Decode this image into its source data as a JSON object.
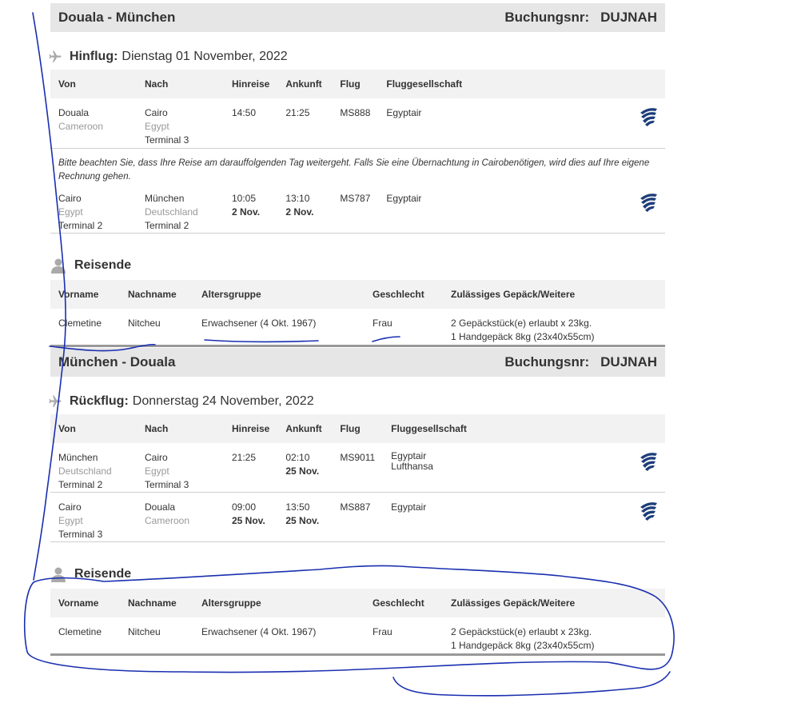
{
  "outbound": {
    "route": "Douala - München",
    "booking_label": "Buchungsnr:",
    "booking_no": "DUJNAH",
    "direction_label": "Hinflug:",
    "date": "Dienstag 01 November, 2022",
    "headers": [
      "Von",
      "Nach",
      "Hinreise",
      "Ankunft",
      "Flug",
      "Fluggesellschaft"
    ],
    "legs": [
      {
        "from_city": "Douala",
        "from_country": "Cameroon",
        "from_terminal": "",
        "to_city": "Cairo",
        "to_country": "Egypt",
        "to_terminal": "Terminal 3",
        "dep": "14:50",
        "dep_date": "",
        "arr": "21:25",
        "arr_date": "",
        "flight": "MS888",
        "airline": "Egyptair",
        "airline2": ""
      },
      {
        "from_city": "Cairo",
        "from_country": "Egypt",
        "from_terminal": "Terminal 2",
        "to_city": "München",
        "to_country": "Deutschland",
        "to_terminal": "Terminal 2",
        "dep": "10:05",
        "dep_date": "2 Nov.",
        "arr": "13:10",
        "arr_date": "2 Nov.",
        "flight": "MS787",
        "airline": "Egyptair",
        "airline2": ""
      }
    ],
    "note": "Bitte beachten Sie, dass Ihre Reise am darauffolgenden Tag weitergeht. Falls Sie eine Übernachtung in Cairobenötigen, wird dies auf Ihre eigene Rechnung gehen."
  },
  "return": {
    "route": "München - Douala",
    "booking_label": "Buchungsnr:",
    "booking_no": "DUJNAH",
    "direction_label": "Rückflug:",
    "date": "Donnerstag 24 November, 2022",
    "headers": [
      "Von",
      "Nach",
      "Hinreise",
      "Ankunft",
      "Flug",
      "Fluggesellschaft"
    ],
    "legs": [
      {
        "from_city": "München",
        "from_country": "Deutschland",
        "from_terminal": "Terminal 2",
        "to_city": "Cairo",
        "to_country": "Egypt",
        "to_terminal": "Terminal 3",
        "dep": "21:25",
        "dep_date": "",
        "arr": "02:10",
        "arr_date": "25 Nov.",
        "flight": "MS9011",
        "airline": "Egyptair",
        "airline2": "Lufthansa"
      },
      {
        "from_city": "Cairo",
        "from_country": "Egypt",
        "from_terminal": "Terminal 3",
        "to_city": "Douala",
        "to_country": "Cameroon",
        "to_terminal": "",
        "dep": "09:00",
        "dep_date": "25 Nov.",
        "arr": "13:50",
        "arr_date": "25 Nov.",
        "flight": "MS887",
        "airline": "Egyptair",
        "airline2": ""
      }
    ]
  },
  "travellers": {
    "title": "Reisende",
    "headers": [
      "Vorname",
      "Nachname",
      "Altersgruppe",
      "Geschlecht",
      "Zulässiges Gepäck/Weitere"
    ],
    "row": {
      "first": "Clemetine",
      "last": "Nitcheu",
      "age": "Erwachsener (4 Okt. 1967)",
      "gender": "Frau",
      "bag1": "2 Gepäckstück(e) erlaubt x 23kg.",
      "bag2": "1 Handgepäck 8kg (23x40x55cm)"
    }
  },
  "icons": {
    "plane": "plane-icon",
    "person": "person-icon",
    "airline_logo": "egyptair-logo-icon"
  },
  "colors": {
    "annotation": "#1a2fb0",
    "logo": "#1d3d7a",
    "header_bg": "#e6e6e6"
  }
}
